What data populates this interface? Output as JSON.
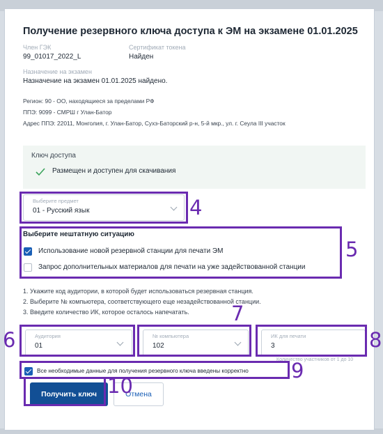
{
  "dialog": {
    "title": "Получение резервного ключа доступа к ЭМ на экзамене 01.01.2025",
    "member_label": "Член ГЭК",
    "member_value": "99_01017_2022_L",
    "cert_label": "Сертификат токена",
    "cert_value": "Найден",
    "assignment_label": "Назначение на экзамен",
    "assignment_value": "Назначение на экзамен 01.01.2025 найдено.",
    "region": "Регион: 90 - ОО, находящиеся за пределами РФ",
    "ppe": "ППЭ: 9099 - СМРШ г Улан-Батор",
    "address": "Адрес ППЭ: 22011, Монголия, г. Улан-Батор, Сухэ-Баторский р-н, 5-й мкр., ул. г. Сеула III участок"
  },
  "access_key": {
    "label": "Ключ доступа",
    "status": "Размещен и доступен для скачивания",
    "status_icon": "check-icon",
    "status_color": "#3aa35b"
  },
  "subject_select": {
    "label": "Выберите предмет",
    "value": "01 - Русский язык"
  },
  "situation": {
    "heading": "Выберите нештатную ситуацию",
    "options": [
      {
        "label": "Использование новой резервной станции для печати ЭМ",
        "checked": true
      },
      {
        "label": "Запрос дополнительных материалов для печати на уже задействованной станции",
        "checked": false
      }
    ]
  },
  "instructions": [
    "1. Укажите код аудитории, в которой будет использоваться резервная станция.",
    "2. Выберите № компьютера, соответствующего еще незадействованной станции.",
    "3. Введите количество ИК, которое осталось напечатать."
  ],
  "auditorium": {
    "label": "Аудитория",
    "value": "01"
  },
  "computer": {
    "label": "№ компьютера",
    "value": "102"
  },
  "ik_count": {
    "label": "ИК для печати",
    "value": "3",
    "hint": "Количество участников от 1 до 10"
  },
  "confirm": {
    "label": "Все необходимые данные для получения резервного ключа введены корректно",
    "checked": true
  },
  "buttons": {
    "get_key": "Получить ключ",
    "cancel": "Отмена"
  },
  "annotations": {
    "n4": "4",
    "n5": "5",
    "n6": "6",
    "n7": "7",
    "n8": "8",
    "n9": "9",
    "n10": "10"
  },
  "colors": {
    "primary": "#124f95",
    "annotation": "#6a2bb0",
    "checkbox": "#1a5fb6"
  }
}
